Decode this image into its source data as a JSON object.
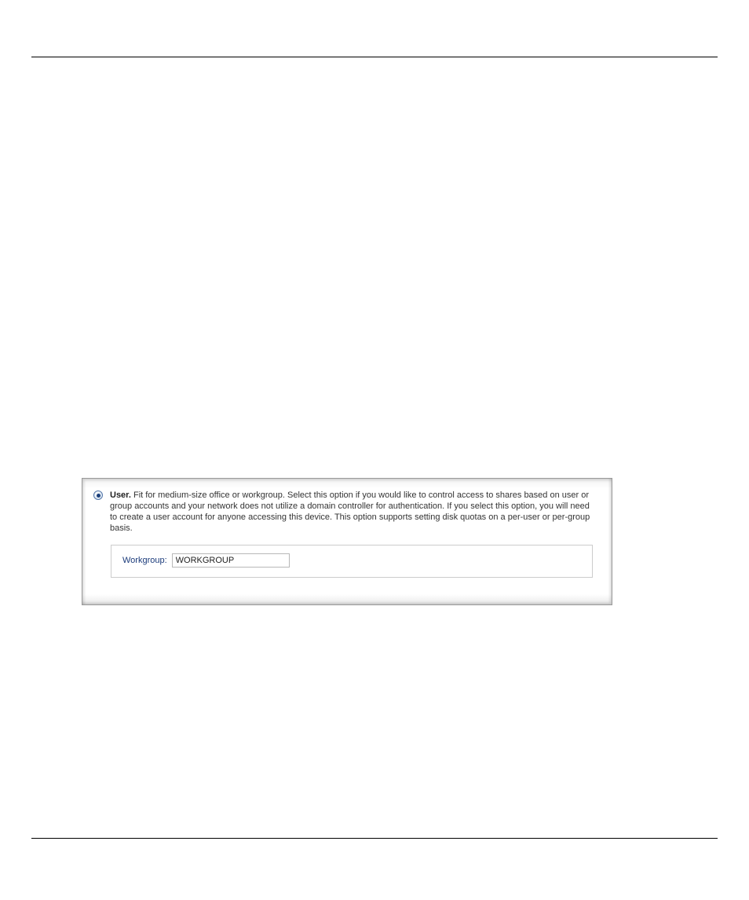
{
  "option": {
    "title": "User.",
    "description": " Fit for medium-size office or workgroup. Select this option if you would like to control access to shares based on user or group accounts and your network does not utilize a domain controller for authentication. If you select this option, you will need to create a user account for anyone accessing this device. This option supports setting disk quotas on a per-user or per-group basis.",
    "selected": true
  },
  "workgroup": {
    "label": "Workgroup:",
    "value": "WORKGROUP"
  }
}
